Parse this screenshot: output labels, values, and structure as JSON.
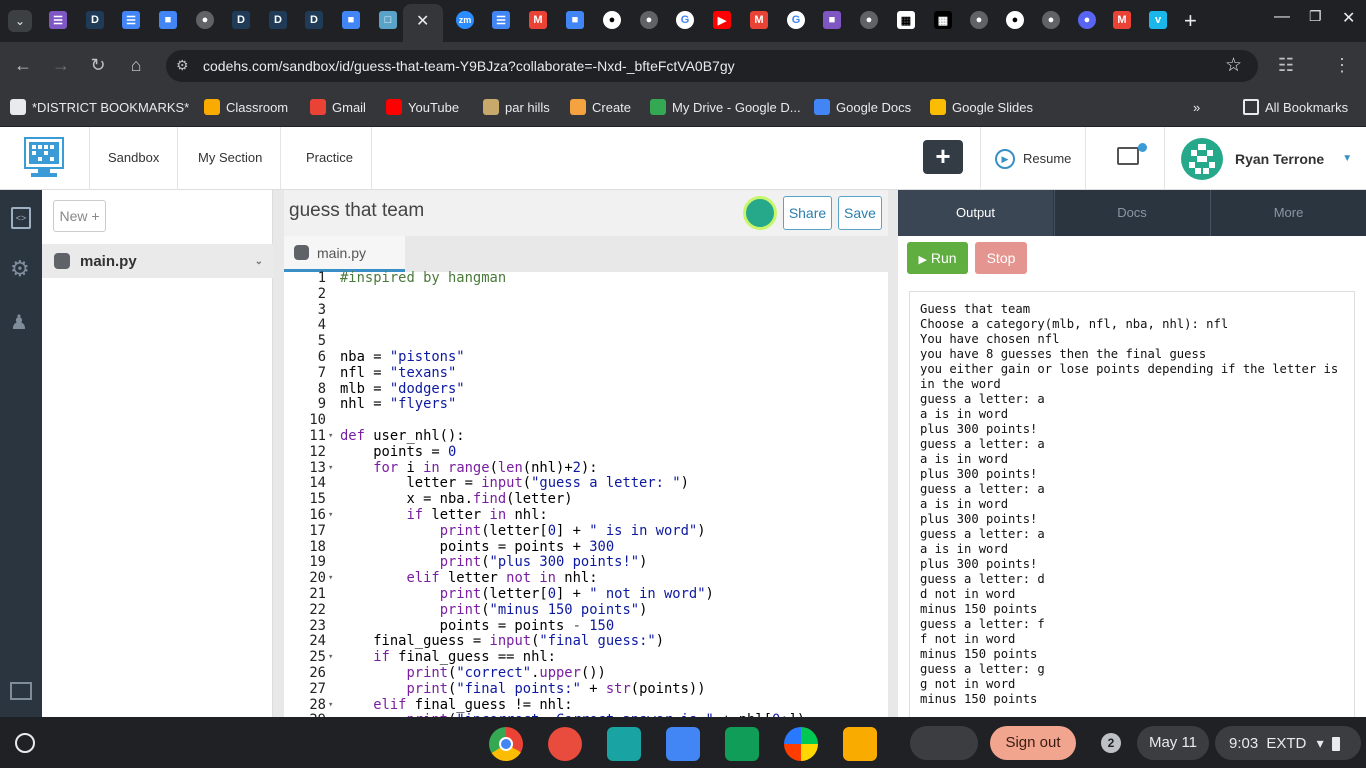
{
  "browser": {
    "url": "codehs.com/sandbox/id/guess-that-team-Y9BJza?collaborate=-Nxd-_bfteFctVA0B7gy",
    "bookmarks": [
      {
        "label": "*DISTRICT BOOKMARKS*",
        "icon": "folder-icon",
        "color": "#e8eaed"
      },
      {
        "label": "Classroom",
        "icon": "classroom-icon",
        "color": "#f9ab00"
      },
      {
        "label": "Gmail",
        "icon": "gmail-icon",
        "color": "#ea4335"
      },
      {
        "label": "YouTube",
        "icon": "youtube-icon",
        "color": "#ff0000"
      },
      {
        "label": "par hills",
        "icon": "par-hills-icon",
        "color": "#c6a96b"
      },
      {
        "label": "Create",
        "icon": "create-icon",
        "color": "#f4a340"
      },
      {
        "label": "My Drive - Google D...",
        "icon": "drive-icon",
        "color": "#34a853"
      },
      {
        "label": "Google Docs",
        "icon": "docs-icon",
        "color": "#4285f4"
      },
      {
        "label": "Google Slides",
        "icon": "slides-icon",
        "color": "#fbbc04"
      }
    ],
    "all_bookmarks": "All Bookmarks"
  },
  "header": {
    "nav": [
      "Sandbox",
      "My Section",
      "Practice"
    ],
    "plus": "+",
    "resume": "Resume",
    "user_name": "Ryan Terrone"
  },
  "files": {
    "new_button": "New +",
    "main_file": "main.py"
  },
  "editor": {
    "title": "guess that team",
    "share": "Share",
    "save": "Save",
    "tab": "main.py"
  },
  "output": {
    "tabs": [
      "Output",
      "Docs",
      "More"
    ],
    "run": "Run",
    "stop": "Stop",
    "console": [
      "Guess that team",
      "Choose a category(mlb, nfl, nba, nhl): nfl",
      "You have chosen nfl",
      "you have 8 guesses then the final guess",
      "you either gain or lose points depending if the letter is in the word",
      "guess a letter: a",
      "a is in word",
      "plus 300 points!",
      "guess a letter: a",
      "a is in word",
      "plus 300 points!",
      "guess a letter: a",
      "a is in word",
      "plus 300 points!",
      "guess a letter: a",
      "a is in word",
      "plus 300 points!",
      "guess a letter: d",
      "d not in word",
      "minus 150 points",
      "guess a letter: f",
      "f not in word",
      "minus 150 points",
      "guess a letter: g",
      "g not in word",
      "minus 150 points"
    ]
  },
  "shelf": {
    "sign_out": "Sign out",
    "notifications": "2",
    "date": "May 11",
    "time": "9:03",
    "extd": "EXTD"
  }
}
